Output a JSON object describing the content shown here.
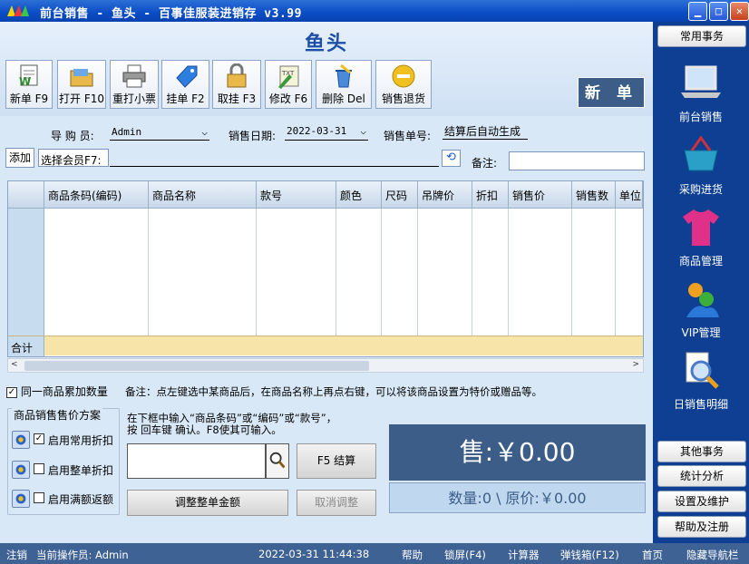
{
  "window": {
    "title": "前台销售 - 鱼头 - 百事佳服装进销存 v3.99"
  },
  "store_name": "鱼头",
  "toolbar": [
    {
      "label": "新单 F9",
      "icon": "new-doc-icon"
    },
    {
      "label": "打开 F10",
      "icon": "open-folder-icon"
    },
    {
      "label": "重打小票",
      "icon": "printer-icon"
    },
    {
      "label": "挂单 F2",
      "icon": "tag-icon"
    },
    {
      "label": "取挂 F3",
      "icon": "padlock-icon"
    },
    {
      "label": "修改 F6",
      "icon": "edit-txt-icon"
    },
    {
      "label": "删除 Del",
      "icon": "delete-icon"
    },
    {
      "label": "销售退货",
      "icon": "return-icon"
    }
  ],
  "mode_label": "新 单",
  "form": {
    "salesperson_label": "导 购 员:",
    "salesperson_value": "Admin",
    "date_label": "销售日期:",
    "date_value": "2022-03-31",
    "order_no_label": "销售单号:",
    "order_no_value": "结算后自动生成",
    "add_label": "添加",
    "member_label": "选择会员F7:",
    "member_value": "",
    "note_label": "备注:",
    "note_value": ""
  },
  "grid": {
    "columns": [
      "商品条码(编码)",
      "商品名称",
      "款号",
      "颜色",
      "尺码",
      "吊牌价",
      "折扣",
      "销售价",
      "销售数",
      "单位"
    ],
    "rows": [],
    "sum_label": "合计"
  },
  "options": {
    "accumulate_label": "同一商品累加数量",
    "accumulate_checked": true,
    "hint": "备注：点左键选中某商品后，在商品名称上再点右键，可以将该商品设置为特价或赠品等。"
  },
  "scheme": {
    "title": "商品销售售价方案",
    "items": [
      {
        "label": "启用常用折扣",
        "checked": true
      },
      {
        "label": "启用整单折扣",
        "checked": false
      },
      {
        "label": "启用满额返额",
        "checked": false
      }
    ]
  },
  "entry": {
    "hint_line1": "在下框中输入“商品条码”或“编码”或“款号”，",
    "hint_line2": "按 回车键 确认。F8使其可输入。",
    "input_value": "",
    "checkout_label": "F5 结算",
    "adjust_label": "调整整单金额",
    "cancel_adjust_label": "取消调整"
  },
  "totals": {
    "sale_label": "售:￥0.00",
    "summary_label": "数量:0 \\ 原价:￥0.00"
  },
  "sidebar": {
    "top_label": "常用事务",
    "items": [
      {
        "label": "前台销售",
        "icon": "laptop-icon"
      },
      {
        "label": "采购进货",
        "icon": "basket-icon"
      },
      {
        "label": "商品管理",
        "icon": "tshirt-icon"
      },
      {
        "label": "VIP管理",
        "icon": "vip-users-icon"
      },
      {
        "label": "日销售明细",
        "icon": "magnifier-doc-icon"
      }
    ],
    "bottom": [
      "其他事务",
      "统计分析",
      "设置及维护",
      "帮助及注册"
    ]
  },
  "statusbar": {
    "logout": "注销",
    "operator": "当前操作员: Admin",
    "datetime": "2022-03-31 11:44:38",
    "links": [
      "帮助",
      "锁屏(F4)",
      "计算器",
      "弹钱箱(F12)",
      "首页",
      "隐藏导航栏"
    ]
  },
  "colors": {
    "accent": "#3c5d88",
    "title_blue": "#0a4cc4",
    "sidebar": "#0e3f93",
    "sum_row": "#f6e4a8"
  }
}
